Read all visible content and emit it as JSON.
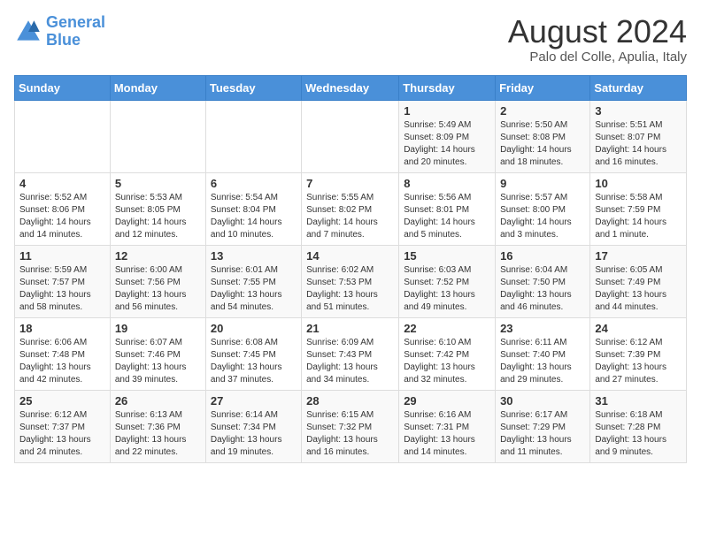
{
  "logo": {
    "line1": "General",
    "line2": "Blue"
  },
  "title": "August 2024",
  "subtitle": "Palo del Colle, Apulia, Italy",
  "days_of_week": [
    "Sunday",
    "Monday",
    "Tuesday",
    "Wednesday",
    "Thursday",
    "Friday",
    "Saturday"
  ],
  "weeks": [
    [
      {
        "day": "",
        "info": ""
      },
      {
        "day": "",
        "info": ""
      },
      {
        "day": "",
        "info": ""
      },
      {
        "day": "",
        "info": ""
      },
      {
        "day": "1",
        "info": "Sunrise: 5:49 AM\nSunset: 8:09 PM\nDaylight: 14 hours\nand 20 minutes."
      },
      {
        "day": "2",
        "info": "Sunrise: 5:50 AM\nSunset: 8:08 PM\nDaylight: 14 hours\nand 18 minutes."
      },
      {
        "day": "3",
        "info": "Sunrise: 5:51 AM\nSunset: 8:07 PM\nDaylight: 14 hours\nand 16 minutes."
      }
    ],
    [
      {
        "day": "4",
        "info": "Sunrise: 5:52 AM\nSunset: 8:06 PM\nDaylight: 14 hours\nand 14 minutes."
      },
      {
        "day": "5",
        "info": "Sunrise: 5:53 AM\nSunset: 8:05 PM\nDaylight: 14 hours\nand 12 minutes."
      },
      {
        "day": "6",
        "info": "Sunrise: 5:54 AM\nSunset: 8:04 PM\nDaylight: 14 hours\nand 10 minutes."
      },
      {
        "day": "7",
        "info": "Sunrise: 5:55 AM\nSunset: 8:02 PM\nDaylight: 14 hours\nand 7 minutes."
      },
      {
        "day": "8",
        "info": "Sunrise: 5:56 AM\nSunset: 8:01 PM\nDaylight: 14 hours\nand 5 minutes."
      },
      {
        "day": "9",
        "info": "Sunrise: 5:57 AM\nSunset: 8:00 PM\nDaylight: 14 hours\nand 3 minutes."
      },
      {
        "day": "10",
        "info": "Sunrise: 5:58 AM\nSunset: 7:59 PM\nDaylight: 14 hours\nand 1 minute."
      }
    ],
    [
      {
        "day": "11",
        "info": "Sunrise: 5:59 AM\nSunset: 7:57 PM\nDaylight: 13 hours\nand 58 minutes."
      },
      {
        "day": "12",
        "info": "Sunrise: 6:00 AM\nSunset: 7:56 PM\nDaylight: 13 hours\nand 56 minutes."
      },
      {
        "day": "13",
        "info": "Sunrise: 6:01 AM\nSunset: 7:55 PM\nDaylight: 13 hours\nand 54 minutes."
      },
      {
        "day": "14",
        "info": "Sunrise: 6:02 AM\nSunset: 7:53 PM\nDaylight: 13 hours\nand 51 minutes."
      },
      {
        "day": "15",
        "info": "Sunrise: 6:03 AM\nSunset: 7:52 PM\nDaylight: 13 hours\nand 49 minutes."
      },
      {
        "day": "16",
        "info": "Sunrise: 6:04 AM\nSunset: 7:50 PM\nDaylight: 13 hours\nand 46 minutes."
      },
      {
        "day": "17",
        "info": "Sunrise: 6:05 AM\nSunset: 7:49 PM\nDaylight: 13 hours\nand 44 minutes."
      }
    ],
    [
      {
        "day": "18",
        "info": "Sunrise: 6:06 AM\nSunset: 7:48 PM\nDaylight: 13 hours\nand 42 minutes."
      },
      {
        "day": "19",
        "info": "Sunrise: 6:07 AM\nSunset: 7:46 PM\nDaylight: 13 hours\nand 39 minutes."
      },
      {
        "day": "20",
        "info": "Sunrise: 6:08 AM\nSunset: 7:45 PM\nDaylight: 13 hours\nand 37 minutes."
      },
      {
        "day": "21",
        "info": "Sunrise: 6:09 AM\nSunset: 7:43 PM\nDaylight: 13 hours\nand 34 minutes."
      },
      {
        "day": "22",
        "info": "Sunrise: 6:10 AM\nSunset: 7:42 PM\nDaylight: 13 hours\nand 32 minutes."
      },
      {
        "day": "23",
        "info": "Sunrise: 6:11 AM\nSunset: 7:40 PM\nDaylight: 13 hours\nand 29 minutes."
      },
      {
        "day": "24",
        "info": "Sunrise: 6:12 AM\nSunset: 7:39 PM\nDaylight: 13 hours\nand 27 minutes."
      }
    ],
    [
      {
        "day": "25",
        "info": "Sunrise: 6:12 AM\nSunset: 7:37 PM\nDaylight: 13 hours\nand 24 minutes."
      },
      {
        "day": "26",
        "info": "Sunrise: 6:13 AM\nSunset: 7:36 PM\nDaylight: 13 hours\nand 22 minutes."
      },
      {
        "day": "27",
        "info": "Sunrise: 6:14 AM\nSunset: 7:34 PM\nDaylight: 13 hours\nand 19 minutes."
      },
      {
        "day": "28",
        "info": "Sunrise: 6:15 AM\nSunset: 7:32 PM\nDaylight: 13 hours\nand 16 minutes."
      },
      {
        "day": "29",
        "info": "Sunrise: 6:16 AM\nSunset: 7:31 PM\nDaylight: 13 hours\nand 14 minutes."
      },
      {
        "day": "30",
        "info": "Sunrise: 6:17 AM\nSunset: 7:29 PM\nDaylight: 13 hours\nand 11 minutes."
      },
      {
        "day": "31",
        "info": "Sunrise: 6:18 AM\nSunset: 7:28 PM\nDaylight: 13 hours\nand 9 minutes."
      }
    ]
  ]
}
